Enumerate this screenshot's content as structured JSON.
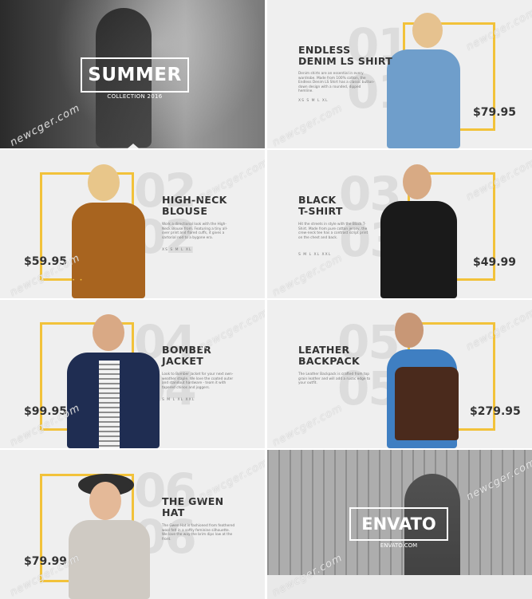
{
  "hero": {
    "title": "SUMMER",
    "subtitle": "COLLECTION 2016"
  },
  "products": [
    {
      "num": "01",
      "title_l1": "ENDLESS",
      "title_l2": "DENIM LS SHIRT",
      "desc": "Denim shirts are an essential in every wardrobe. Made from 100% cotton, the Endless Denim LS Shirt has a classic button-down design with a rounded, dipped hemline.",
      "sizes": "XS S M L XL",
      "price": "$79.95"
    },
    {
      "num": "02",
      "title_l1": "HIGH-NECK",
      "title_l2": "BLOUSE",
      "desc": "Work a directional look with the High-Neck Blouse from. Featuring a tiny all-over print and flared cuffs, it gives a sartorial nod to a bygone era.",
      "sizes": "XS S M L XL",
      "price": "$59.95"
    },
    {
      "num": "03",
      "title_l1": "BLACK",
      "title_l2": "T-SHIRT",
      "desc": "Hit the streets in style with the Black T-Shirt. Made from pure cotton jersey, the crew-neck tee has a contrast script print on the chest and back.",
      "sizes": "S M L XL XXL",
      "price": "$49.99"
    },
    {
      "num": "04",
      "title_l1": "BOMBER",
      "title_l2": "JACKET",
      "desc": "Look to Bomber Jacket for your next own-weather staple. We love the coated outer and standout hardware - team it with tapered chinos and joggers.",
      "sizes": "S M L XL XXL",
      "price": "$99.95"
    },
    {
      "num": "05",
      "title_l1": "LEATHER",
      "title_l2": "BACKPACK",
      "desc": "The Leather Backpack is crafted from top grain leather and will add a rustic edge to your outfit.",
      "sizes": "",
      "price": "$279.95"
    },
    {
      "num": "06",
      "title_l1": "THE GWEN",
      "title_l2": "HAT",
      "desc": "The Gwen Hat is fashioned from feathered wool felt in a softly feminine silhouette. We love the way the brim dips low at the front.",
      "sizes": "",
      "price": "$79.99"
    }
  ],
  "outro": {
    "title": "ENVATO",
    "subtitle": "ENVATO.COM"
  },
  "watermark": "newcger.com",
  "colors": {
    "accent": "#f2c23a",
    "background": "#efefef",
    "text": "#333333"
  }
}
